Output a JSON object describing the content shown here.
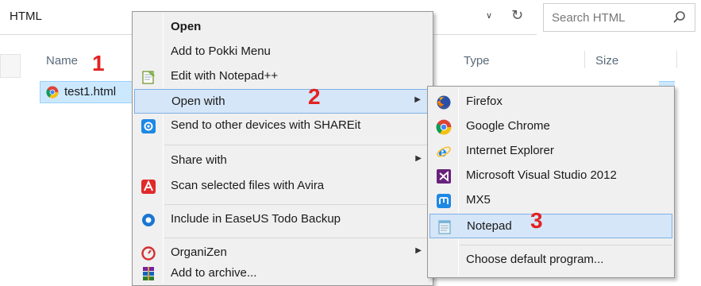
{
  "address": {
    "path": "HTML"
  },
  "search": {
    "placeholder": "Search HTML"
  },
  "columns": {
    "name": "Name",
    "type": "Type",
    "size": "Size"
  },
  "file": {
    "name": "test1.html"
  },
  "steps": [
    "1",
    "2",
    "3"
  ],
  "context_menu": {
    "items": [
      {
        "label": "Open",
        "icon": "none",
        "bold": true
      },
      {
        "label": "Add to Pokki Menu",
        "icon": "none"
      },
      {
        "label": "Edit with Notepad++",
        "icon": "notepadpp-icon"
      },
      {
        "label": "Open with",
        "icon": "none",
        "submenu": true,
        "highlighted": true
      },
      {
        "label": "Send to other devices with SHAREit",
        "icon": "shareit-icon"
      },
      {
        "label": "Share with",
        "icon": "none",
        "submenu": true
      },
      {
        "label": "Scan selected files with Avira",
        "icon": "avira-icon"
      },
      {
        "label": "Include in EaseUS Todo Backup",
        "icon": "easeus-icon"
      },
      {
        "label": "OrganiZen",
        "icon": "organizen-icon",
        "submenu": true
      },
      {
        "label": "Add to archive...",
        "icon": "winrar-icon"
      }
    ]
  },
  "open_with_menu": {
    "items": [
      {
        "label": "Firefox",
        "icon": "firefox-icon"
      },
      {
        "label": "Google Chrome",
        "icon": "chrome-icon"
      },
      {
        "label": "Internet Explorer",
        "icon": "ie-icon"
      },
      {
        "label": "Microsoft Visual Studio 2012",
        "icon": "visual-studio-icon"
      },
      {
        "label": "MX5",
        "icon": "mx5-icon"
      },
      {
        "label": "Notepad",
        "icon": "notepad-icon",
        "highlighted": true
      },
      {
        "label": "Choose default program...",
        "icon": "none"
      }
    ]
  },
  "colors": {
    "step_marker": "#e32222",
    "highlight": "#d5e6f8",
    "selection": "#cce8ff"
  }
}
